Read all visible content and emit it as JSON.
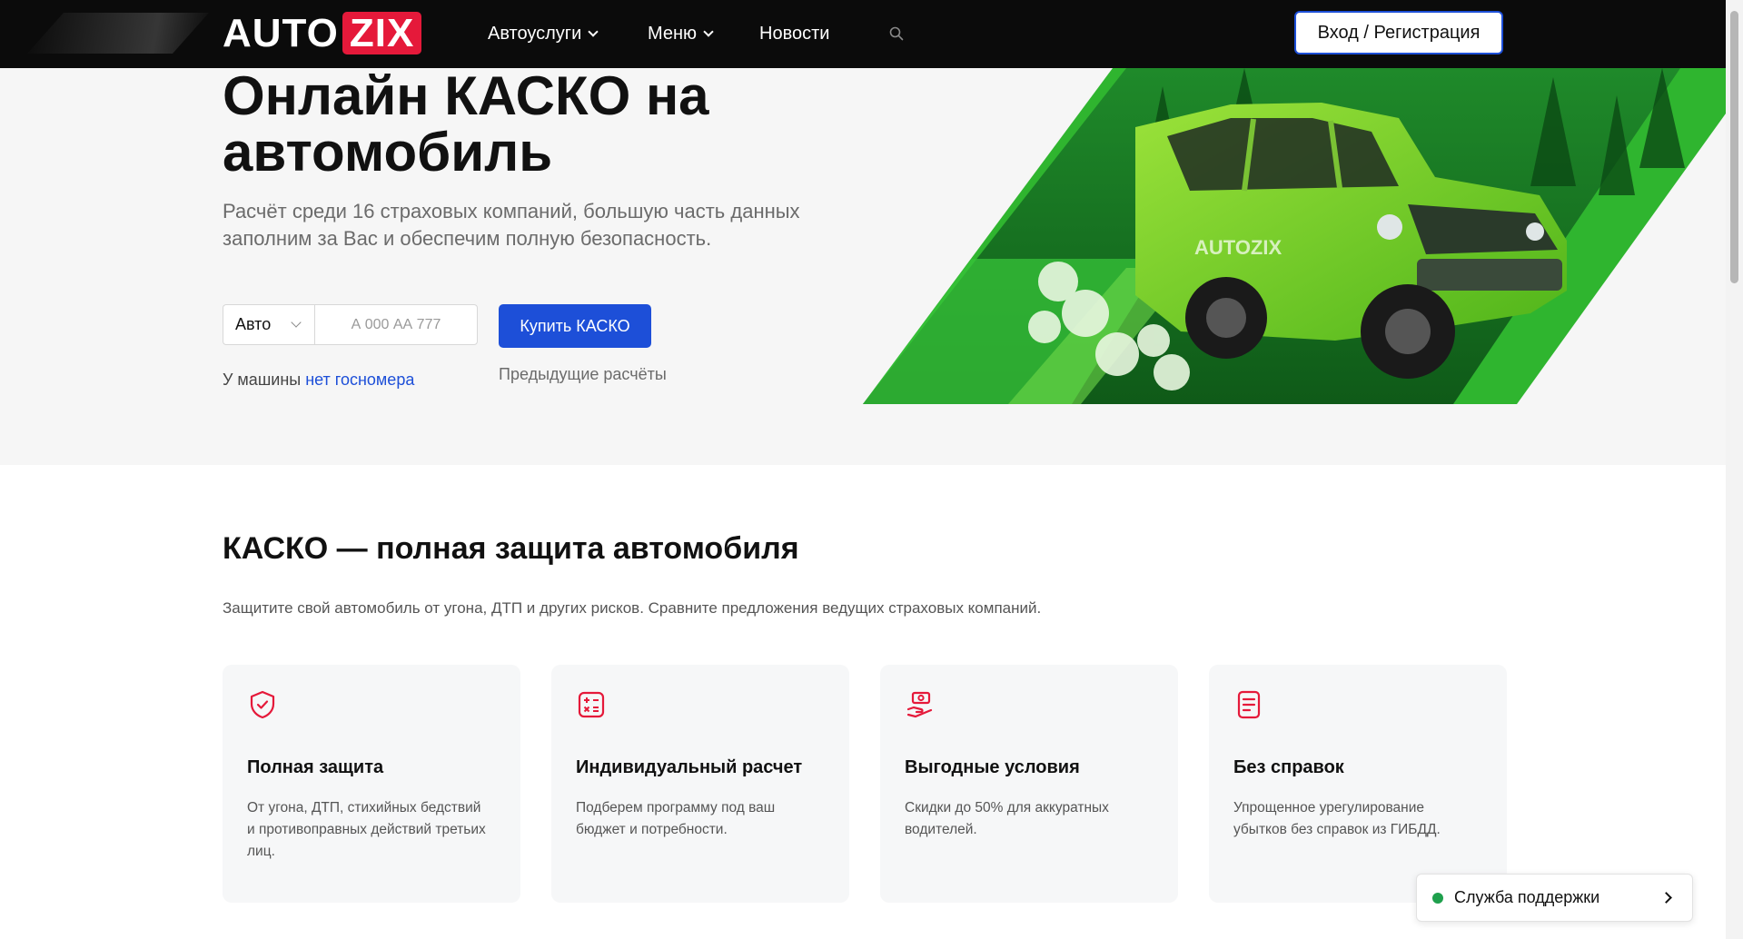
{
  "header": {
    "logo": {
      "part1": "AUTO",
      "part2": "ZIX"
    },
    "nav": {
      "services": "Автоуслуги",
      "menu": "Меню",
      "news": "Новости"
    },
    "login_label": "Вход / Регистрация"
  },
  "hero": {
    "title": "Онлайн КАСКО на автомобиль",
    "subtitle": "Расчёт среди 16 страховых компаний, большую часть данных заполним за Вас и обеспечим полную безопасность.",
    "vehicle_type": "Авто",
    "plate_placeholder": "А 000 АА 777",
    "buy_label": "Купить КАСКО",
    "noplate_prefix": "У машины ",
    "noplate_link": "нет госномера",
    "previous_calcs": "Предыдущие расчёты",
    "car_logo_text": "AUTOZIX"
  },
  "section": {
    "title": "КАСКО — полная защита автомобиля",
    "description": "Защитите свой автомобиль от угона, ДТП и других рисков. Сравните предложения ведущих страховых компаний.",
    "cards": [
      {
        "icon": "shield-check-icon",
        "title": "Полная защита",
        "text": "От угона, ДТП, стихийных бедствий и противоправных действий третьих лиц."
      },
      {
        "icon": "calculator-icon",
        "title": "Индивидуальный расчет",
        "text": "Подберем программу под ваш бюджет и потребности."
      },
      {
        "icon": "hand-money-icon",
        "title": "Выгодные условия",
        "text": "Скидки до 50% для аккуратных водителей."
      },
      {
        "icon": "document-icon",
        "title": "Без справок",
        "text": "Упрощенное урегулирование убытков без справок из ГИБДД."
      }
    ]
  },
  "support": {
    "label": "Служба поддержки"
  },
  "colors": {
    "brand_red": "#e5193a",
    "accent_blue": "#1d4fd8",
    "header_bg": "#0b0b0b",
    "hero_green": "#2fb52f",
    "online_green": "#1fa04d"
  }
}
